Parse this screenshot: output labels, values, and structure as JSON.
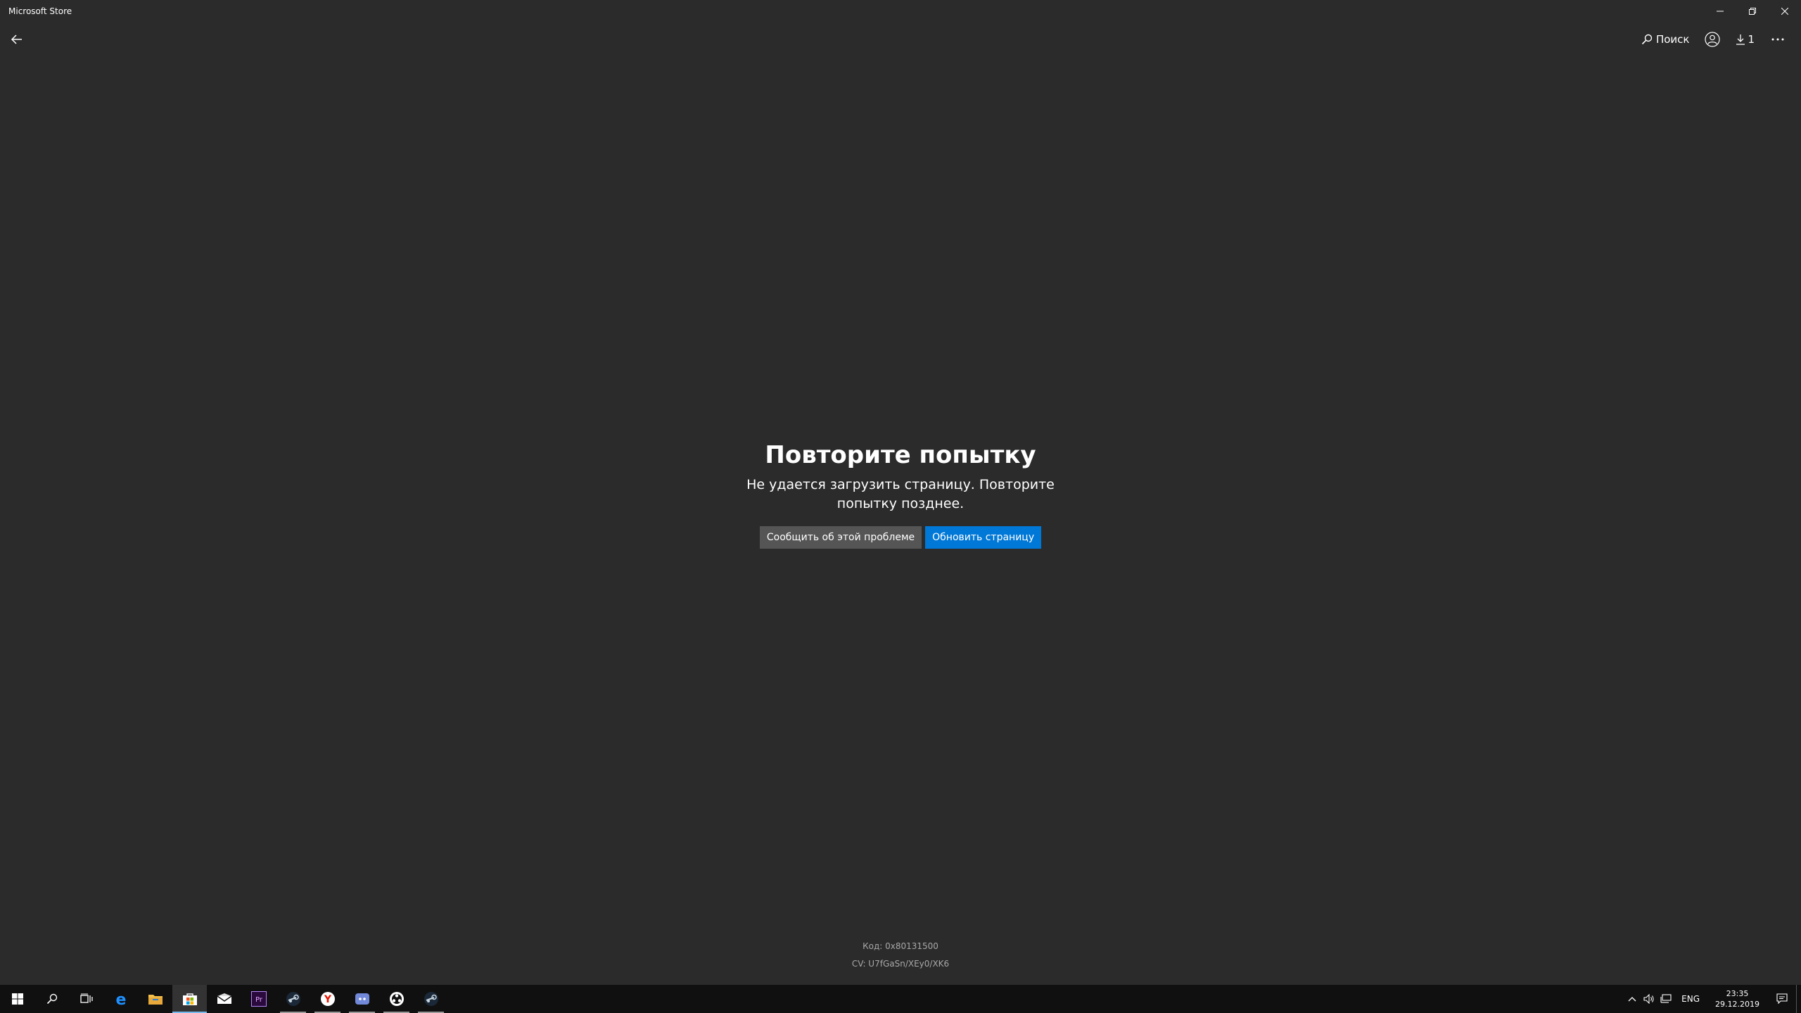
{
  "window": {
    "title": "Microsoft Store"
  },
  "nav": {
    "search_label": "Поиск",
    "downloads_count": "1"
  },
  "error": {
    "title": "Повторите попытку",
    "message": "Не удается загрузить страницу. Повторите попытку позднее.",
    "report_button": "Сообщить об этой проблеме",
    "refresh_button": "Обновить страницу",
    "code": "Код: 0x80131500",
    "cv": "CV: U7fGaSn/XEy0/XK6"
  },
  "taskbar": {
    "apps": [
      "start-icon",
      "search-icon",
      "task-view-icon",
      "edge-icon",
      "file-explorer-icon",
      "store-icon",
      "mail-icon",
      "premiere-icon",
      "steam-icon",
      "yandex-icon",
      "discord-icon",
      "obs-icon",
      "steam-icon"
    ],
    "language": "ENG",
    "time": "23:35",
    "date": "29.12.2019"
  },
  "colors": {
    "background": "#2b2b2b",
    "accent": "#0078d7",
    "secondary_button": "#555555",
    "taskbar": "#101010"
  }
}
